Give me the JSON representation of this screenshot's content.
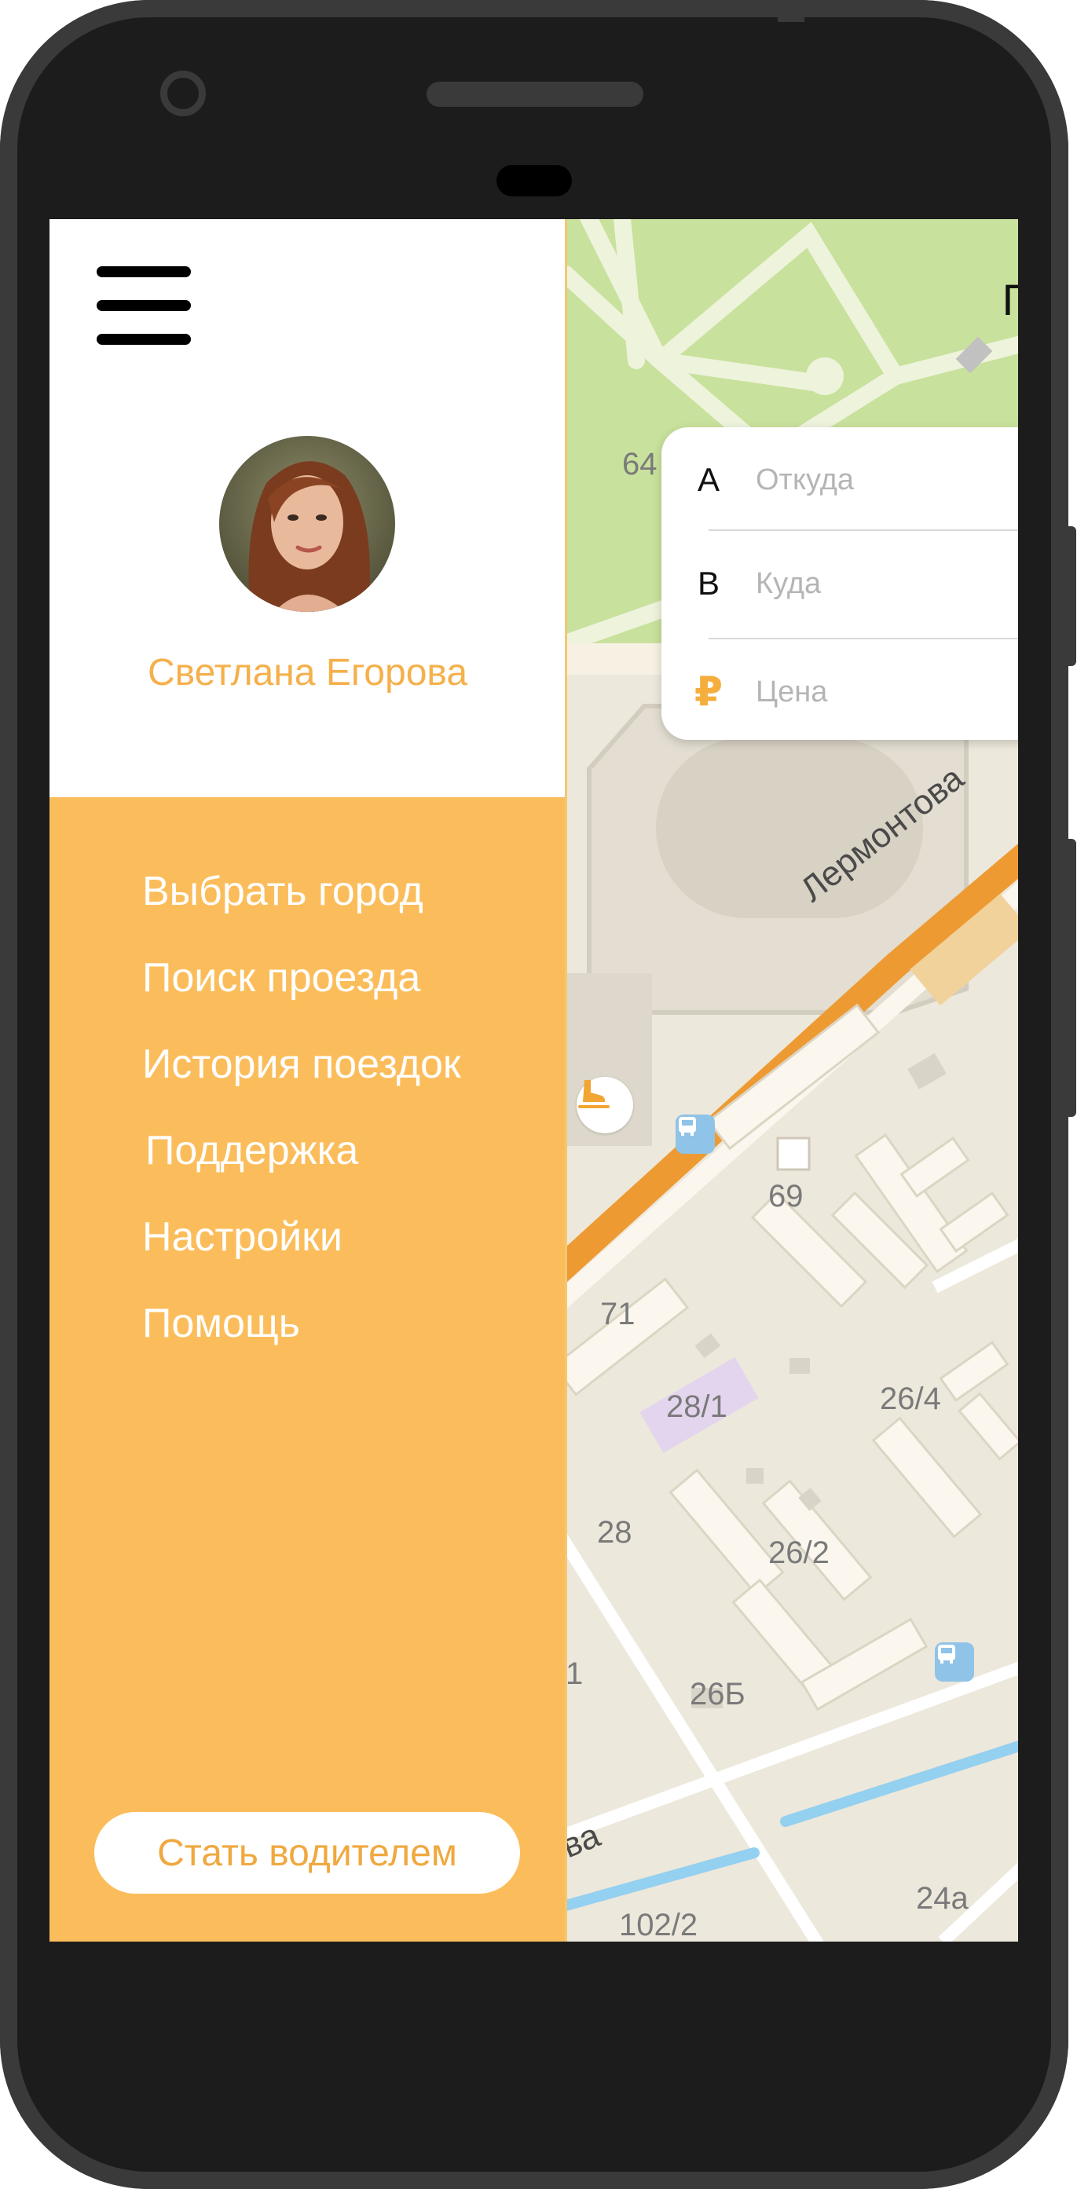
{
  "map": {
    "header_peek": "П",
    "labels": [
      "64",
      "69",
      "71",
      "28/1",
      "26/4",
      "28",
      "26/2",
      "1",
      "26Б",
      "24а",
      "102/2"
    ],
    "street_name": "Лермонтова",
    "street_fragment": "ва"
  },
  "route": {
    "from_letter": "A",
    "from_placeholder": "Откуда",
    "to_letter": "B",
    "to_placeholder": "Куда",
    "price_symbol": "₽",
    "price_placeholder": "Цена"
  },
  "drawer": {
    "user_name": "Светлана Егорова",
    "menu": [
      "Выбрать город",
      "Поиск проезда",
      "История поездок",
      "Поддержка",
      "Настройки",
      "Помощь"
    ],
    "become_driver": "Стать водителем"
  },
  "colors": {
    "accent": "#fbbd5b",
    "accent_text": "#f5b04b",
    "phone_body": "#1c1c1c"
  },
  "icons": [
    "menu-icon",
    "avatar",
    "ice-skate-icon",
    "bus-stop-icon"
  ]
}
